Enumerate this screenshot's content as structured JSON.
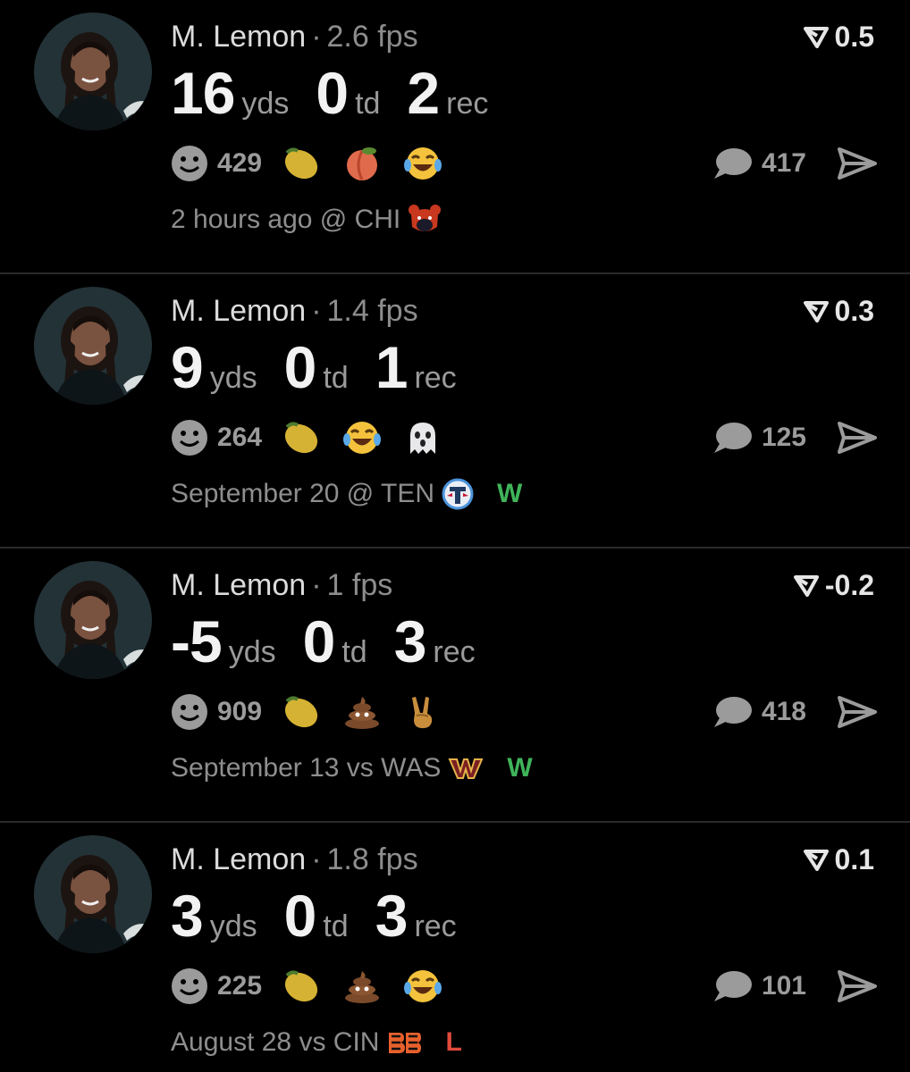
{
  "colors": {
    "background": "#000000",
    "divider": "#2a2a2a",
    "win": "#3fb45a",
    "loss": "#e24a3b",
    "muted": "#8d8d8d"
  },
  "icons": {
    "reaction": "smiley-face-icon",
    "score": "fantasy-points-icon",
    "comment": "speech-bubble-icon",
    "share": "share-arrow-icon",
    "lemon": "lemon-emoji",
    "peach": "peach-emoji",
    "laugh": "tears-of-joy-emoji",
    "ghost": "ghost-emoji",
    "poop": "pile-of-poo-emoji",
    "victory": "victory-hand-emoji"
  },
  "posts": [
    {
      "player": "M. Lemon",
      "separator": "·",
      "fps": "2.6 fps",
      "score": "0.5",
      "yds": "16",
      "yds_label": "yds",
      "td": "0",
      "td_label": "td",
      "rec": "2",
      "rec_label": "rec",
      "reaction_count": "429",
      "emojis": [
        "lemon",
        "peach",
        "laugh"
      ],
      "comments": "417",
      "game": "2 hours ago @ CHI",
      "team_logo": "bears-logo",
      "result": ""
    },
    {
      "player": "M. Lemon",
      "separator": "·",
      "fps": "1.4 fps",
      "score": "0.3",
      "yds": "9",
      "yds_label": "yds",
      "td": "0",
      "td_label": "td",
      "rec": "1",
      "rec_label": "rec",
      "reaction_count": "264",
      "emojis": [
        "lemon",
        "laugh",
        "ghost"
      ],
      "comments": "125",
      "game": "September 20 @ TEN",
      "team_logo": "titans-logo",
      "result": "W"
    },
    {
      "player": "M. Lemon",
      "separator": "·",
      "fps": "1 fps",
      "score": "-0.2",
      "yds": "-5",
      "yds_label": "yds",
      "td": "0",
      "td_label": "td",
      "rec": "3",
      "rec_label": "rec",
      "reaction_count": "909",
      "emojis": [
        "lemon",
        "poop",
        "victory"
      ],
      "comments": "418",
      "game": "September 13 vs WAS",
      "team_logo": "commanders-logo",
      "result": "W"
    },
    {
      "player": "M. Lemon",
      "separator": "·",
      "fps": "1.8 fps",
      "score": "0.1",
      "yds": "3",
      "yds_label": "yds",
      "td": "0",
      "td_label": "td",
      "rec": "3",
      "rec_label": "rec",
      "reaction_count": "225",
      "emojis": [
        "lemon",
        "poop",
        "laugh"
      ],
      "comments": "101",
      "game": "August 28 vs CIN",
      "team_logo": "bengals-logo",
      "result": "L"
    }
  ]
}
